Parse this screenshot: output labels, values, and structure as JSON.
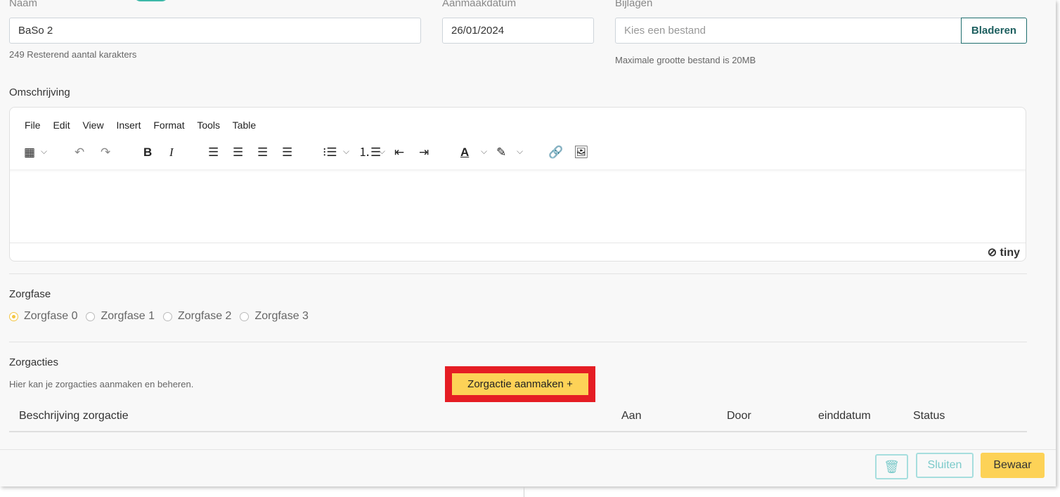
{
  "form": {
    "name_label": "Naam",
    "name_value": "BaSo 2",
    "name_help": "249 Resterend aantal karakters",
    "date_label": "Aanmaakdatum",
    "date_value": "26/01/2024",
    "attach_label": "Bijlagen",
    "attach_placeholder": "Kies een bestand",
    "attach_browse": "Bladeren",
    "attach_help": "Maximale grootte bestand is 20MB"
  },
  "description": {
    "label": "Omschrijving",
    "menubar": [
      "File",
      "Edit",
      "View",
      "Insert",
      "Format",
      "Tools",
      "Table"
    ],
    "brand": "tiny"
  },
  "phase": {
    "label": "Zorgfase",
    "options": [
      "Zorgfase 0",
      "Zorgfase 1",
      "Zorgfase 2",
      "Zorgfase 3"
    ],
    "selected": "Zorgfase 0"
  },
  "actions": {
    "title": "Zorgacties",
    "help": "Hier kan je zorgacties aanmaken en beheren.",
    "create_button": "Zorgactie aanmaken +",
    "columns": [
      "Beschrijving zorgactie",
      "Aan",
      "Door",
      "einddatum",
      "Status"
    ]
  },
  "footer": {
    "close_label": "Sluiten",
    "save_label": "Bewaar"
  },
  "colors": {
    "accent_yellow": "#fdd257",
    "teal": "#3cb8a8",
    "highlight_red": "#e51d24"
  }
}
